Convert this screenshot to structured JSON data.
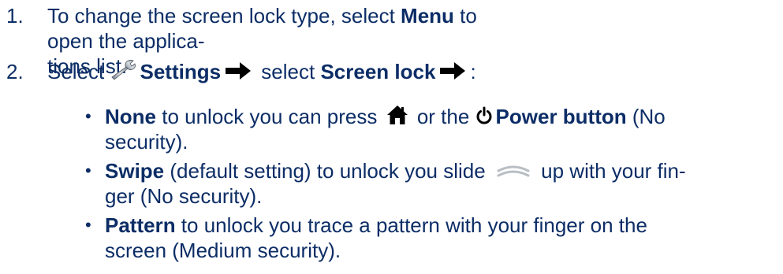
{
  "steps": [
    {
      "number": "1.",
      "line1_pre": "To change the screen lock type, select ",
      "line1_bold": "Menu",
      "line1_post": " to open the applica-",
      "line2": "tions list."
    },
    {
      "number": "2.",
      "pre": "Select ",
      "settings_bold": "Settings",
      "mid": " select ",
      "screen_lock_bold": "Screen lock",
      "post": ":"
    }
  ],
  "bullets": [
    {
      "dot": "•",
      "bold": "None",
      "text_a": " to unlock you can press ",
      "text_b": " or the ",
      "power_bold": "Power button",
      "text_c": " (No",
      "line2": "security)."
    },
    {
      "dot": "•",
      "bold": "Swipe",
      "text_a": " (default setting) to unlock you slide ",
      "text_b": " up with your fin-",
      "line2": "ger (No security)."
    },
    {
      "dot": "•",
      "bold": "Pattern",
      "text_a": " to unlock you trace a pattern with your finger on the",
      "line2": "screen (Medium security)."
    }
  ],
  "icons": {
    "wrench": "wrench-icon",
    "arrow": "arrow-right-icon",
    "home": "home-icon",
    "power": "power-icon",
    "swipe": "swipe-up-icon"
  },
  "colors": {
    "text": "#0c2d66"
  }
}
